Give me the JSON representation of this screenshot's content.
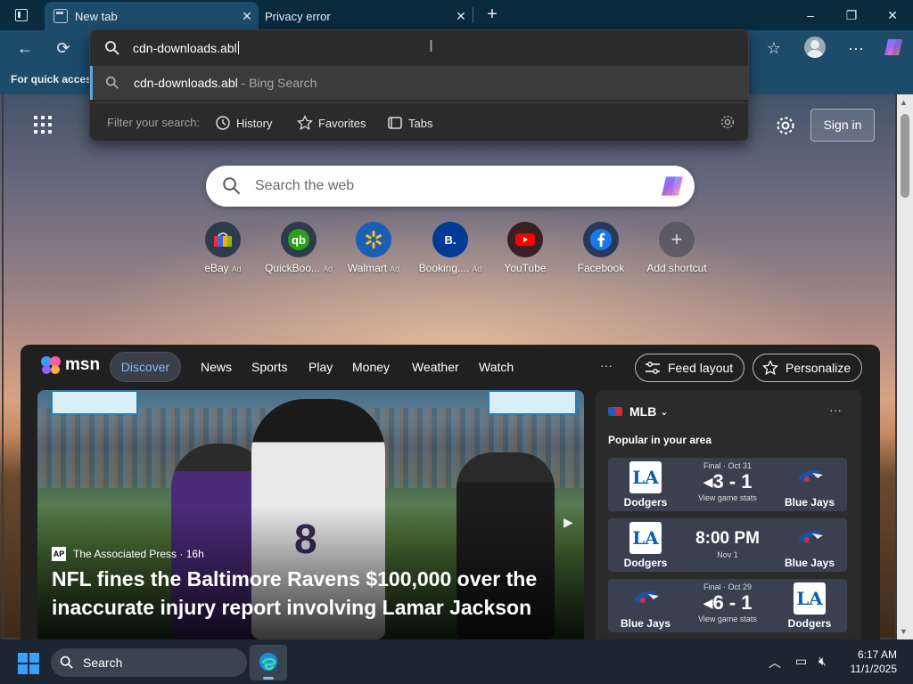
{
  "tabs": [
    {
      "label": "New tab",
      "active": true
    },
    {
      "label": "Privacy error",
      "active": false
    }
  ],
  "window_controls": {
    "minimize": "–",
    "maximize": "❐",
    "close": "✕"
  },
  "favorites_bar": {
    "text": "For quick access"
  },
  "address_bar": {
    "value": "cdn-downloads.abl",
    "suggestion": {
      "query": "cdn-downloads.abl",
      "source": " - Bing Search"
    },
    "filter_label": "Filter your search:",
    "filters": [
      "History",
      "Favorites",
      "Tabs"
    ]
  },
  "ntp": {
    "sign_in": "Sign in",
    "search_placeholder": "Search the web",
    "shortcuts": [
      {
        "name": "eBay",
        "ad": "Ad",
        "icon": "ebay-icon"
      },
      {
        "name": "QuickBoo...",
        "ad": "Ad",
        "icon": "quickbooks-icon"
      },
      {
        "name": "Walmart",
        "ad": "Ad",
        "icon": "walmart-icon"
      },
      {
        "name": "Booking....",
        "ad": "Ad",
        "icon": "booking-icon"
      },
      {
        "name": "YouTube",
        "ad": "",
        "icon": "youtube-icon"
      },
      {
        "name": "Facebook",
        "ad": "",
        "icon": "facebook-icon"
      },
      {
        "name": "Add shortcut",
        "ad": "",
        "icon": "plus-icon"
      }
    ]
  },
  "feed": {
    "logo": "msn",
    "nav": [
      "Discover",
      "News",
      "Sports",
      "Play",
      "Money",
      "Weather",
      "Watch"
    ],
    "more": "···",
    "feed_layout": "Feed layout",
    "personalize": "Personalize",
    "hero": {
      "source": "The Associated Press",
      "age": "· 16h",
      "headline": "NFL fines the Baltimore Ravens $100,000 over the inaccurate injury report involving Lamar Jackson",
      "jersey": "8"
    },
    "sports": {
      "league": "MLB",
      "more": "···",
      "subtitle": "Popular in your area",
      "games": [
        {
          "status": "Final · Oct 31",
          "score": "◂3 - 1",
          "small": "View game stats",
          "left": "Dodgers",
          "right": "Blue Jays"
        },
        {
          "status": "",
          "score": "8:00 PM",
          "small": "Nov 1",
          "left": "Dodgers",
          "right": "Blue Jays"
        },
        {
          "status": "Final · Oct 29",
          "score": "◂6 - 1",
          "small": "View game stats",
          "left": "Blue Jays",
          "right": "Dodgers"
        }
      ]
    }
  },
  "taskbar": {
    "search": "Search",
    "time": "6:17 AM",
    "date": "11/1/2025"
  },
  "colors": {
    "accent": "#1d4c6b",
    "link": "#8ab4f8",
    "taskbar": "#1c2633"
  }
}
